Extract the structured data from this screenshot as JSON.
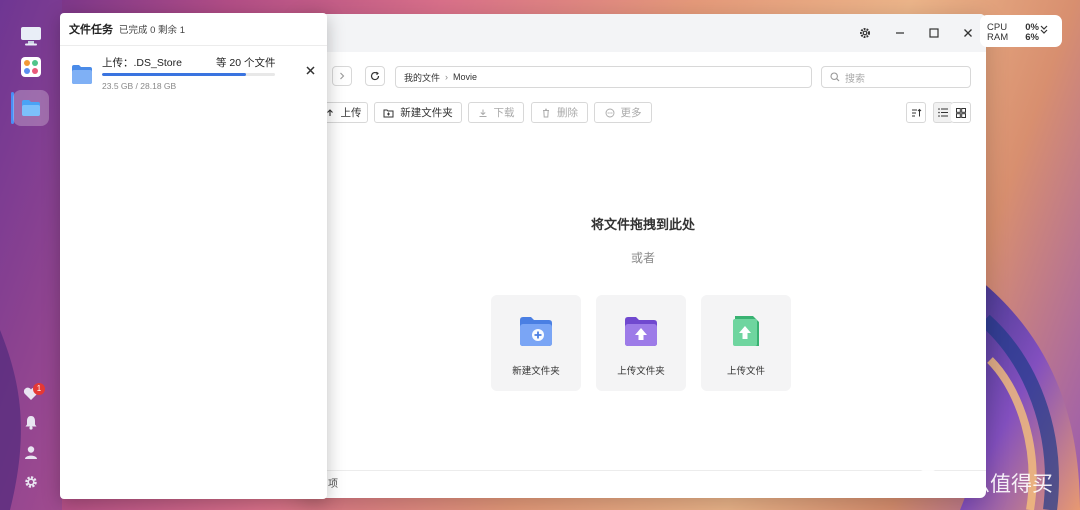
{
  "tasks_panel": {
    "title": "文件任务",
    "status": "已完成 0 剩余 1",
    "items": [
      {
        "name": "上传：.DS_Store",
        "count_label": "等 20 个文件",
        "size_label": "23.5 GB / 28.18 GB",
        "progress": 0.834
      }
    ]
  },
  "window": {
    "path": [
      "我的文件",
      "Movie"
    ],
    "search_placeholder": "搜索",
    "toolbar": {
      "upload": "上传",
      "new_folder": "新建文件夹",
      "download": "下载",
      "delete": "删除",
      "more": "更多"
    },
    "drop_title": "将文件拖拽到此处",
    "drop_or": "或者",
    "cards": [
      {
        "label": "新建文件夹",
        "icon": "folder-plus-icon",
        "color": "#5b8ff0"
      },
      {
        "label": "上传文件夹",
        "icon": "folder-upload-icon",
        "color": "#8a63e0"
      },
      {
        "label": "上传文件",
        "icon": "file-upload-icon",
        "color": "#4fc58a"
      }
    ],
    "status_text": "项"
  },
  "resource_monitor": {
    "cpu_label": "CPU",
    "cpu_value": "0%",
    "ram_label": "RAM",
    "ram_value": "6%"
  },
  "dock": {
    "notification_count": "1"
  },
  "watermark": {
    "logo_char": "值",
    "text": "什么值得买"
  },
  "colors": {
    "accent": "#3a74e0",
    "badge": "#e53935"
  }
}
